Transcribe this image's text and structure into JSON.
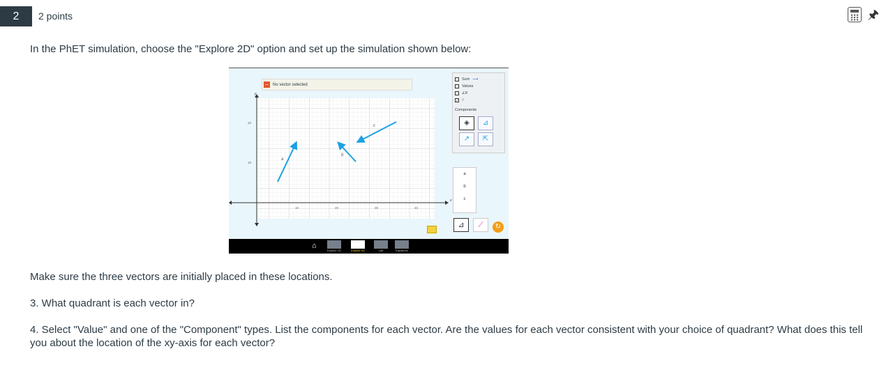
{
  "question": {
    "number": "2",
    "points": "2 points"
  },
  "intro": "In the PhET simulation, choose the \"Explore 2D\" option and set up the simulation shown below:",
  "text1": "Make sure the three vectors are initially placed in these locations.",
  "text2": "3. What quadrant is each vector in?",
  "text3": "4. Select \"Value\" and one of the \"Component\" types. List the components for each vector. Are the values for each vector consistent with your choice of quadrant? What does this tell you about the location of the xy-axis for each vector?",
  "sim": {
    "selector": "No vector selected",
    "panel": {
      "sum": "Sum",
      "values": "Values",
      "angle": "∠θ",
      "grid": "#",
      "components": "Components"
    },
    "axis": {
      "x": "x",
      "y": "y"
    },
    "ticks_x": [
      "10",
      "20",
      "30",
      "40"
    ],
    "ticks_y": [
      "20",
      "10"
    ],
    "vector_labels": [
      "a",
      "b",
      "c"
    ],
    "vec_list": [
      "a",
      "b",
      "c"
    ],
    "tabs": [
      "Explore 1D",
      "Explore 2D",
      "Lab",
      "Equations"
    ]
  },
  "colors": {
    "vector": "#1ba1e2",
    "header": "#2d3b45"
  },
  "icons": [
    "calculator-icon",
    "pin-icon",
    "home-icon"
  ]
}
